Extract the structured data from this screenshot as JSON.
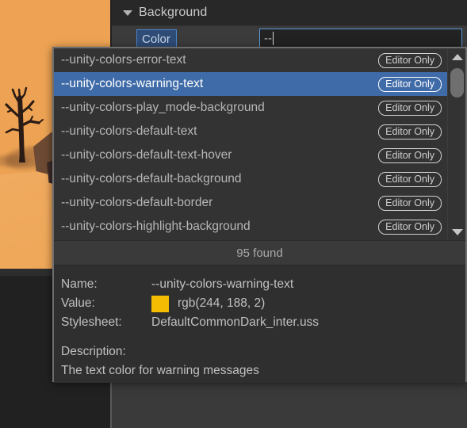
{
  "scene": {
    "name": "scene-view-preview",
    "background_color": "#eda353",
    "tree_color": "#2e1d17"
  },
  "inspector": {
    "foldout": {
      "label": "Background",
      "expanded": true,
      "arrow_icon": "chevron-down-icon"
    },
    "property": {
      "label": "Color",
      "value": "--",
      "placeholder": ""
    }
  },
  "popup": {
    "items": [
      {
        "label": "--unity-colors-error-text",
        "badge": "Editor Only",
        "selected": false
      },
      {
        "label": "--unity-colors-warning-text",
        "badge": "Editor Only",
        "selected": true
      },
      {
        "label": "--unity-colors-play_mode-background",
        "badge": "Editor Only",
        "selected": false
      },
      {
        "label": "--unity-colors-default-text",
        "badge": "Editor Only",
        "selected": false
      },
      {
        "label": "--unity-colors-default-text-hover",
        "badge": "Editor Only",
        "selected": false
      },
      {
        "label": "--unity-colors-default-background",
        "badge": "Editor Only",
        "selected": false
      },
      {
        "label": "--unity-colors-default-border",
        "badge": "Editor Only",
        "selected": false
      },
      {
        "label": "--unity-colors-highlight-background",
        "badge": "Editor Only",
        "selected": false
      }
    ],
    "scrollbar": {
      "up_icon": "triangle-up-icon",
      "down_icon": "triangle-down-icon"
    },
    "found_label": "95 found",
    "details": {
      "name_key": "Name:",
      "name_value": "--unity-colors-warning-text",
      "value_key": "Value:",
      "value_value": "rgb(244, 188, 2)",
      "value_swatch": "#f4bc02",
      "stylesheet_key": "Stylesheet:",
      "stylesheet_value": "DefaultCommonDark_inter.uss",
      "description_key": "Description:",
      "description_value": "The text color for warning messages"
    }
  },
  "colors": {
    "selection_blue": "#3f6ba8",
    "popup_background": "#333333",
    "panel_background": "#3b3b3b",
    "accent_border": "#5a9bd8"
  }
}
